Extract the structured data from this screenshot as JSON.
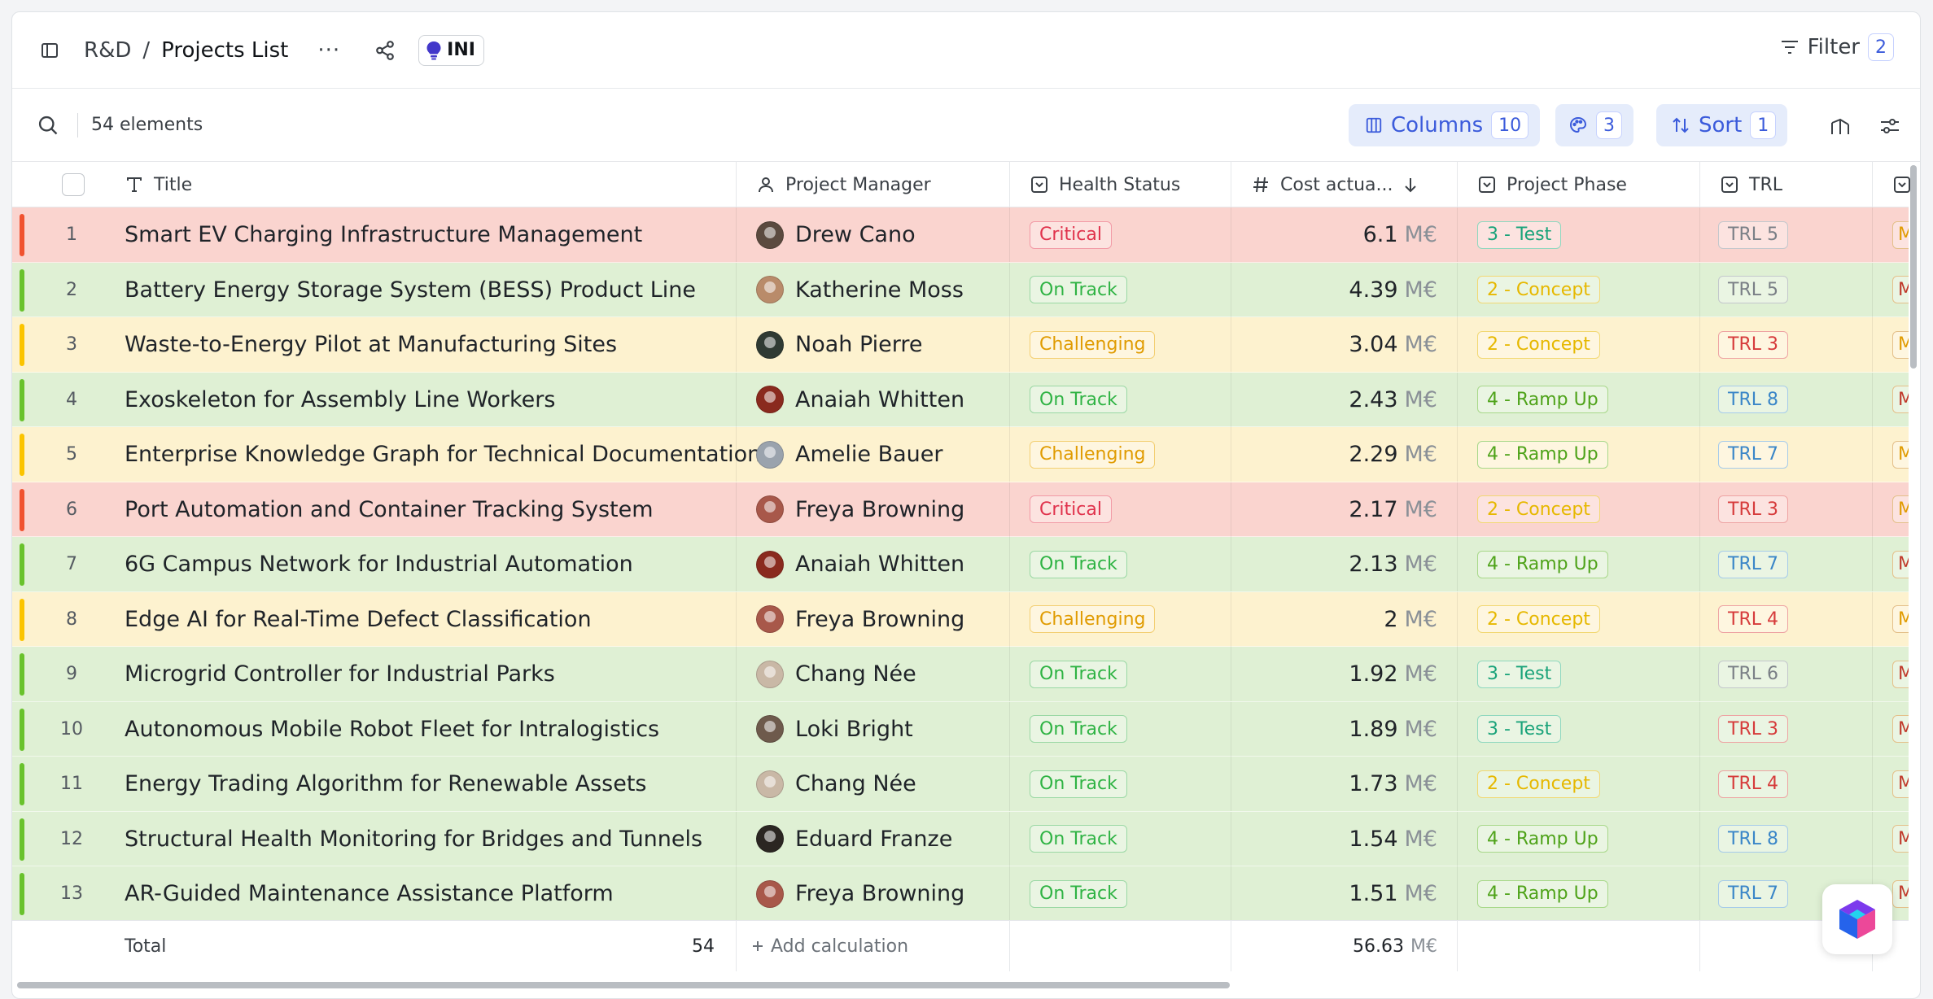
{
  "header": {
    "breadcrumb_parent": "R&D",
    "breadcrumb_sep": "/",
    "breadcrumb_current": "Projects List",
    "more_label": "···",
    "ini_label": "INI",
    "filter_label": "Filter",
    "filter_count": "2"
  },
  "toolbar": {
    "elements_count": "54 elements",
    "columns_label": "Columns",
    "columns_count": "10",
    "colors_count": "3",
    "sort_label": "Sort",
    "sort_count": "1"
  },
  "columns": {
    "title": "Title",
    "project_manager": "Project Manager",
    "health_status": "Health Status",
    "cost": "Cost actua...",
    "project_phase": "Project Phase",
    "trl": "TRL"
  },
  "colors": {
    "critical_row": "#fad4cf",
    "on_track_row": "#dff0d4",
    "challenging_row": "#fdf2cf",
    "critical_bar": "#f0522f",
    "on_track_bar": "#69c22c",
    "challenging_bar": "#fbc400",
    "accent": "#3b5bdb"
  },
  "rows": [
    {
      "num": "1",
      "title": "Smart EV Charging Infrastructure Management",
      "manager": "Drew Cano",
      "avatar": "#5b4a3f",
      "health": "Critical",
      "cost": "6.1",
      "unit": "M€",
      "phase": "3 - Test",
      "trl": "TRL 5",
      "next": "M"
    },
    {
      "num": "2",
      "title": "Battery Energy Storage System (BESS) Product Line",
      "manager": "Katherine Moss",
      "avatar": "#b98b6a",
      "health": "On Track",
      "cost": "4.39",
      "unit": "M€",
      "phase": "2 - Concept",
      "trl": "TRL 5",
      "next": "M"
    },
    {
      "num": "3",
      "title": "Waste-to-Energy Pilot at Manufacturing Sites",
      "manager": "Noah Pierre",
      "avatar": "#2f3a33",
      "health": "Challenging",
      "cost": "3.04",
      "unit": "M€",
      "phase": "2 - Concept",
      "trl": "TRL 3",
      "next": "M"
    },
    {
      "num": "4",
      "title": "Exoskeleton for Assembly Line Workers",
      "manager": "Anaiah Whitten",
      "avatar": "#8a2a1e",
      "health": "On Track",
      "cost": "2.43",
      "unit": "M€",
      "phase": "4 - Ramp Up",
      "trl": "TRL 8",
      "next": "M"
    },
    {
      "num": "5",
      "title": "Enterprise Knowledge Graph for Technical Documentation",
      "manager": "Amelie Bauer",
      "avatar": "#9aa3ad",
      "health": "Challenging",
      "cost": "2.29",
      "unit": "M€",
      "phase": "4 - Ramp Up",
      "trl": "TRL 7",
      "next": "M"
    },
    {
      "num": "6",
      "title": "Port Automation and Container Tracking System",
      "manager": "Freya Browning",
      "avatar": "#a8584a",
      "health": "Critical",
      "cost": "2.17",
      "unit": "M€",
      "phase": "2 - Concept",
      "trl": "TRL 3",
      "next": "M"
    },
    {
      "num": "7",
      "title": "6G Campus Network for Industrial Automation",
      "manager": "Anaiah Whitten",
      "avatar": "#8a2a1e",
      "health": "On Track",
      "cost": "2.13",
      "unit": "M€",
      "phase": "4 - Ramp Up",
      "trl": "TRL 7",
      "next": "M"
    },
    {
      "num": "8",
      "title": "Edge AI for Real-Time Defect Classification",
      "manager": "Freya Browning",
      "avatar": "#a8584a",
      "health": "Challenging",
      "cost": "2",
      "unit": "M€",
      "phase": "2 - Concept",
      "trl": "TRL 4",
      "next": "M"
    },
    {
      "num": "9",
      "title": "Microgrid Controller for Industrial Parks",
      "manager": "Chang Née",
      "avatar": "#c9b8a6",
      "health": "On Track",
      "cost": "1.92",
      "unit": "M€",
      "phase": "3 - Test",
      "trl": "TRL 6",
      "next": "M"
    },
    {
      "num": "10",
      "title": "Autonomous Mobile Robot Fleet for Intralogistics",
      "manager": "Loki Bright",
      "avatar": "#6e5a4c",
      "health": "On Track",
      "cost": "1.89",
      "unit": "M€",
      "phase": "3 - Test",
      "trl": "TRL 3",
      "next": "M"
    },
    {
      "num": "11",
      "title": "Energy Trading Algorithm for Renewable Assets",
      "manager": "Chang Née",
      "avatar": "#c9b8a6",
      "health": "On Track",
      "cost": "1.73",
      "unit": "M€",
      "phase": "2 - Concept",
      "trl": "TRL 4",
      "next": "M"
    },
    {
      "num": "12",
      "title": "Structural Health Monitoring for Bridges and Tunnels",
      "manager": "Eduard Franze",
      "avatar": "#2b2622",
      "health": "On Track",
      "cost": "1.54",
      "unit": "M€",
      "phase": "4 - Ramp Up",
      "trl": "TRL 8",
      "next": "M"
    },
    {
      "num": "13",
      "title": "AR-Guided Maintenance Assistance Platform",
      "manager": "Freya Browning",
      "avatar": "#a8584a",
      "health": "On Track",
      "cost": "1.51",
      "unit": "M€",
      "phase": "4 - Ramp Up",
      "trl": "TRL 7",
      "next": "M"
    }
  ],
  "footer": {
    "total_label": "Total",
    "total_count": "54",
    "add_calc": "Add calculation",
    "cost_total": "56.63",
    "cost_unit": "M€"
  }
}
